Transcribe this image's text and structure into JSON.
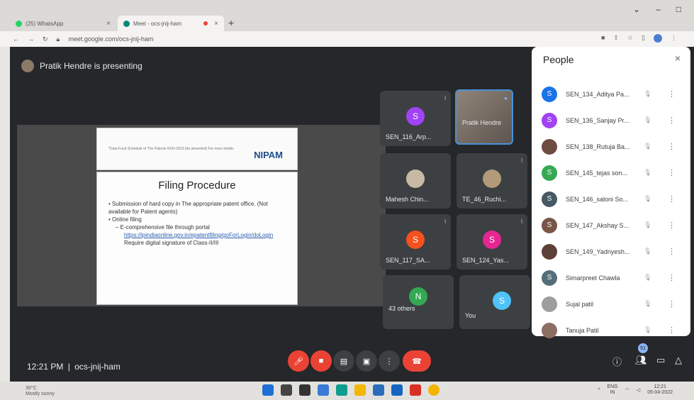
{
  "browser": {
    "tabs": [
      {
        "title": "(25) WhatsApp",
        "icon": "whatsapp-icon",
        "color": "#25d366"
      },
      {
        "title": "Meet - ocs-jnij-ham",
        "icon": "meet-icon",
        "color": "#00897b"
      }
    ],
    "url": "meet.google.com/ocs-jnij-ham",
    "new_tab_label": "+",
    "close_label": "×"
  },
  "meet": {
    "presenting_text": "Pratik Hendre is presenting",
    "slide": {
      "header_small": "*Data-Fund Schedule of The Patents RUN 2023 (As amended) For more details",
      "logo_text": "NIPAM",
      "title": "Filing Procedure",
      "bullets": [
        {
          "type": "b",
          "text": "Submission of hard copy in The appropriate patent office. (Not available for Patent agents)"
        },
        {
          "type": "b",
          "text": "Online filing"
        },
        {
          "type": "s",
          "text": "E-comprehensive file through portal"
        },
        {
          "type": "link",
          "text": "https://ipindiaonline.gov.in/epatentfiling/goForLogin/doLogin"
        },
        {
          "type": "p",
          "text": "Require digital signature of Class-II/III"
        }
      ]
    },
    "tiles": [
      {
        "name": "SEN_116_Arp...",
        "initial": "S",
        "color": "#a142f4"
      },
      {
        "name": "Pratik Hendre",
        "initial": "",
        "color": "#8f8478"
      },
      {
        "name": "Mahesh Chin...",
        "initial": "",
        "color": "#c9b9a4"
      },
      {
        "name": "TE_46_Ruchi...",
        "initial": "",
        "color": "#b39a78"
      },
      {
        "name": "SEN_117_SA...",
        "initial": "S",
        "color": "#f4511e"
      },
      {
        "name": "SEN_124_Yas...",
        "initial": "S",
        "color": "#e52592"
      },
      {
        "name": "43 others",
        "initial": "N",
        "color": "#34a853"
      },
      {
        "name": "You",
        "initial": "S",
        "color": "#4fc3f7"
      }
    ],
    "people": {
      "title": "People",
      "close": "×",
      "list": [
        {
          "name": "SEN_134_Aditya Pa...",
          "initial": "S",
          "color": "#1a73e8"
        },
        {
          "name": "SEN_136_Sanjay Pr...",
          "initial": "S",
          "color": "#a142f4"
        },
        {
          "name": "SEN_138_Rutuja Ba...",
          "initial": "",
          "color": "#6d4c41"
        },
        {
          "name": "SEN_145_tejas son...",
          "initial": "S",
          "color": "#34a853"
        },
        {
          "name": "SEN_146_saloni So...",
          "initial": "S",
          "color": "#455a64"
        },
        {
          "name": "SEN_147_Akshay S...",
          "initial": "S",
          "color": "#795548"
        },
        {
          "name": "SEN_149_Yadnyesh...",
          "initial": "",
          "color": "#5d4037"
        },
        {
          "name": "Simarpreet Chawla",
          "initial": "S",
          "color": "#546e7a"
        },
        {
          "name": "Sujal patil",
          "initial": "",
          "color": "#9e9e9e"
        },
        {
          "name": "Tanuja Patil",
          "initial": "",
          "color": "#8d6e63"
        }
      ]
    },
    "bottom": {
      "time": "12:21 PM",
      "separator": "|",
      "code": "ocs-jnij-ham",
      "participant_badge": "51"
    }
  },
  "taskbar": {
    "weather_temp": "30°C",
    "weather_desc": "Mostly sunny",
    "lang": "ENG",
    "lang2": "IN",
    "clock_time": "12:21",
    "clock_date": "05-04-2022"
  }
}
